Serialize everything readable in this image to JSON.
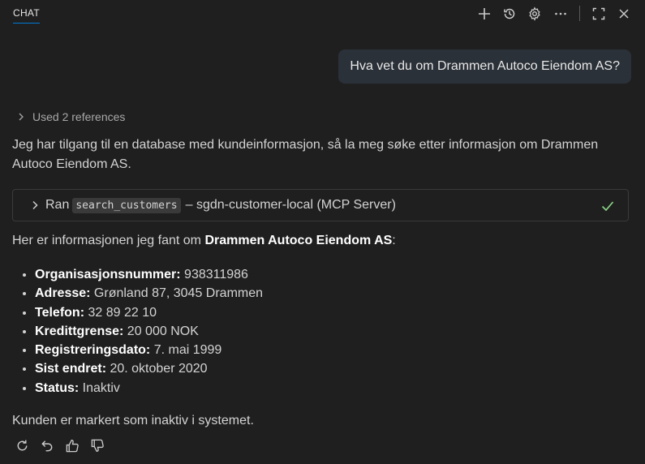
{
  "header": {
    "tab_label": "CHAT",
    "icons": [
      "plus-icon",
      "history-icon",
      "gear-icon",
      "more-icon",
      "maximize-icon",
      "close-icon"
    ]
  },
  "user_message": "Hva vet du om Drammen Autoco Eiendom AS?",
  "references": {
    "label": "Used 2 references"
  },
  "response": {
    "intro": "Jeg har tilgang til en database med kundeinformasjon, så la meg søke etter informasjon om Drammen Autoco Eiendom AS.",
    "tool_call": {
      "prefix": "Ran",
      "tool_name": "search_customers",
      "suffix": "– sgdn-customer-local (MCP Server)",
      "status": "success"
    },
    "found_prefix": "Her er informasjonen jeg fant om ",
    "found_company": "Drammen Autoco Eiendom AS",
    "found_suffix": ":",
    "details": [
      {
        "label": "Organisasjonsnummer:",
        "value": " 938311986"
      },
      {
        "label": "Adresse:",
        "value": " Grønland 87, 3045 Drammen"
      },
      {
        "label": "Telefon:",
        "value": " 32 89 22 10"
      },
      {
        "label": "Kredittgrense:",
        "value": " 20 000 NOK"
      },
      {
        "label": "Registreringsdato:",
        "value": " 7. mai 1999"
      },
      {
        "label": "Sist endret:",
        "value": " 20. oktober 2020"
      },
      {
        "label": "Status:",
        "value": " Inaktiv"
      }
    ],
    "conclusion": "Kunden er markert som inaktiv i systemet."
  },
  "colors": {
    "accent": "#0078d4",
    "success": "#89d185",
    "bubble": "#2b3138"
  }
}
